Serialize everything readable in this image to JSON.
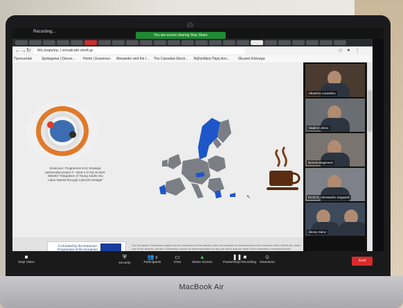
{
  "device": {
    "brand_label": "MacBook Air"
  },
  "recording": {
    "label": "Recording...",
    "share_banner": "You are screen sharing  Stop Share"
  },
  "browser": {
    "url": "Μη ασφαλής | virtualcafe.ekeft.gr",
    "bookmarks": [
      "Προσωπικά",
      "Spotagenai | Discov...",
      "Home | Erasmus+",
      "Alexander and the l...",
      "The Canadian Electr...",
      "Βιβλιοθήκη Πάρη Αυτ...",
      "Ιδιωτικό Κάλεσμα"
    ]
  },
  "page": {
    "caption": "Erasmus+ Programme KA2 Strategic partnership project n° 2019-1-CY01-KA204-065483 \"Integration of Young Adults into Labor Market through Cultural Heritage\"",
    "eu_text": "Co-funded by the Erasmus+ Programme of the European Union",
    "disclaimer": "The European Commission support for the production of this website does not constitute an endorsement of the contents which reflects the views only of the authors, and the Commission cannot be held responsible for any use which may be made of the information contained therein."
  },
  "participants": [
    {
      "name": "Aikaterini Lazaridou"
    },
    {
      "name": "Vladimir Jelisic"
    },
    {
      "name": "Dennis Mogensen"
    },
    {
      "name": "ECSCS_Alessandro Zuppardi"
    },
    {
      "name": "Alexey Salov"
    }
  ],
  "toolbar": {
    "stop_video": "Stop Video",
    "security": "Security",
    "participants": "Participants",
    "participants_count": "6",
    "chat": "Chat",
    "share_screen": "Share Screen",
    "pause_record": "Pause/Stop Recording",
    "reactions": "Reactions",
    "end": "End"
  },
  "colors": {
    "eu_blue": "#1a3c9c",
    "zoom_green": "#1f8a32",
    "end_red": "#d72b2b",
    "map_highlight": "#1e56c9"
  }
}
